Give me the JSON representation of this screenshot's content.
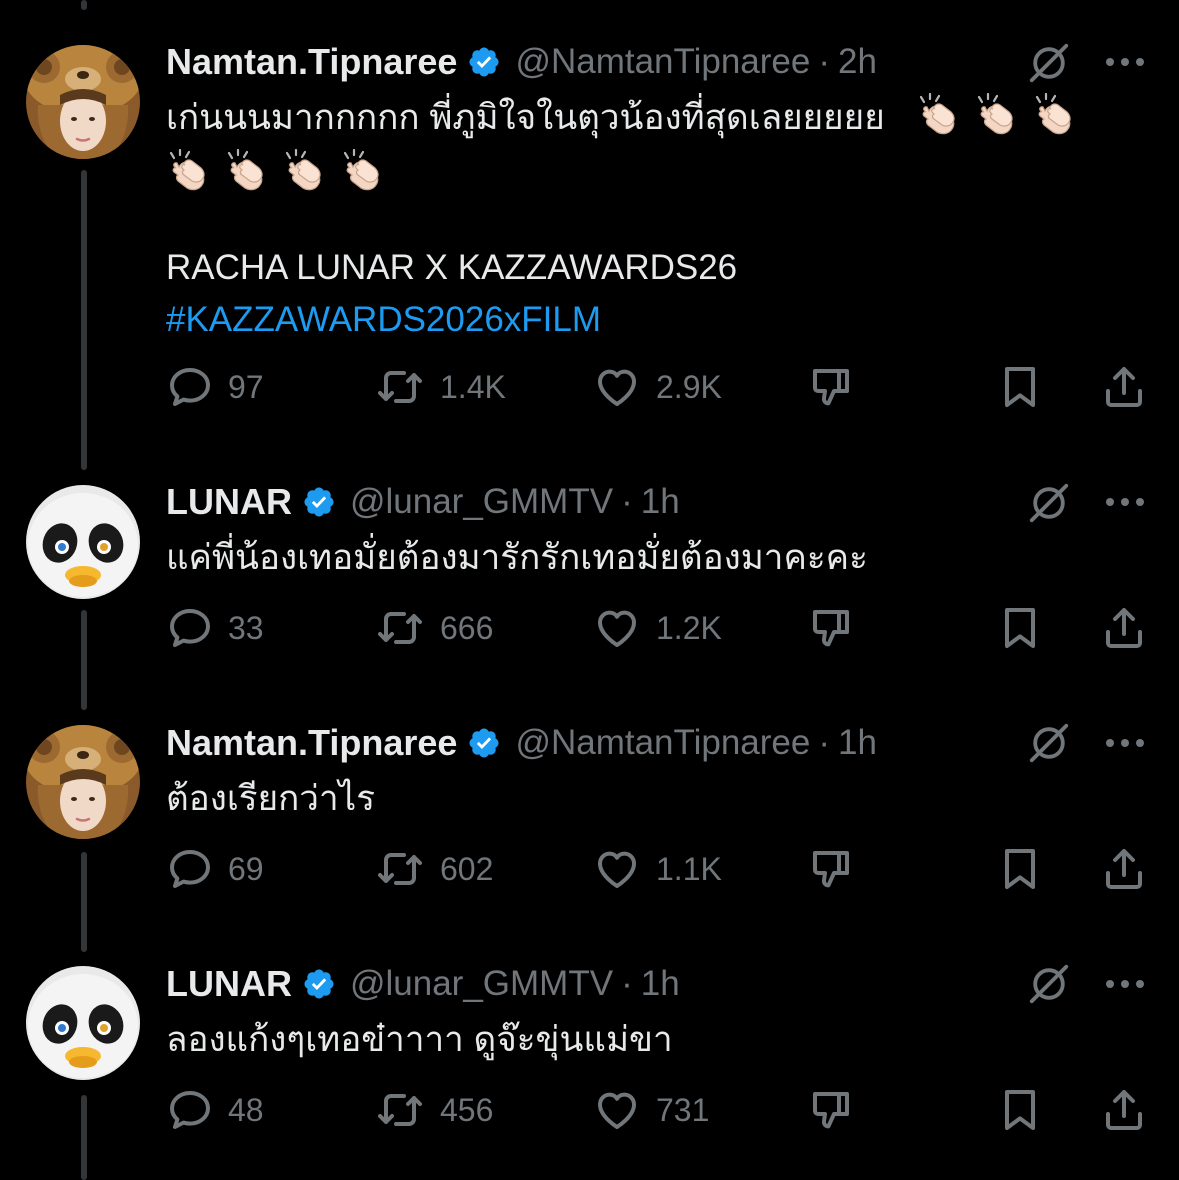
{
  "colors": {
    "background": "#000000",
    "text_primary": "#e7e9ea",
    "text_secondary": "#71767b",
    "link": "#1d9bf0",
    "verified": "#1d9bf0",
    "thread_line": "#333639"
  },
  "tweets": [
    {
      "avatar": "tiger-hat-avatar",
      "name": "Namtan.Tipnaree",
      "verified": true,
      "handle": "@NamtanTipnaree",
      "separator": "·",
      "time": "2h",
      "text_line1": "เก่นนนมากกกกก พี่ภูมิใจในตุวน้องที่สุดเลยยยยย",
      "emoji": "clapping-hands",
      "text_line3": "RACHA LUNAR X KAZZAWARDS26",
      "hashtag": "#KAZZAWARDS2026xFILM",
      "replies": "97",
      "reposts": "1.4K",
      "likes": "2.9K"
    },
    {
      "avatar": "penguin-mascot-avatar",
      "name": "LUNAR",
      "verified": true,
      "handle": "@lunar_GMMTV",
      "separator": "·",
      "time": "1h",
      "text": "แค่พี่น้องเทอมั่ยต้องมารักรักเทอมั่ยต้องมาคะคะ",
      "replies": "33",
      "reposts": "666",
      "likes": "1.2K"
    },
    {
      "avatar": "tiger-hat-avatar",
      "name": "Namtan.Tipnaree",
      "verified": true,
      "handle": "@NamtanTipnaree",
      "separator": "·",
      "time": "1h",
      "text": "ต้องเรียกว่าไร",
      "replies": "69",
      "reposts": "602",
      "likes": "1.1K"
    },
    {
      "avatar": "penguin-mascot-avatar",
      "name": "LUNAR",
      "verified": true,
      "handle": "@lunar_GMMTV",
      "separator": "·",
      "time": "1h",
      "text": "ลองแก้งๆเทอข๋าาาา ดูจ๊ะขุ่นแม่ขา",
      "replies": "48",
      "reposts": "456",
      "likes": "731"
    }
  ]
}
